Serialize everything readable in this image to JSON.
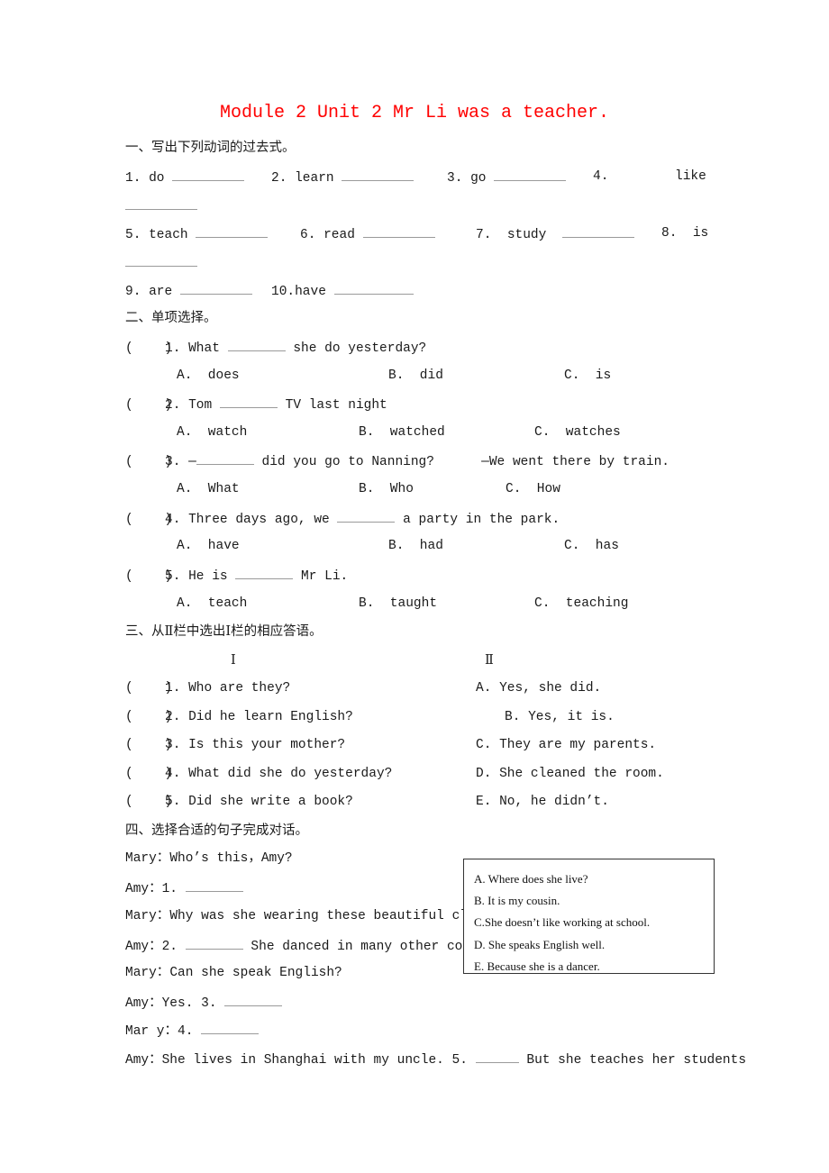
{
  "title": "Module 2 Unit 2 Mr Li was a teacher.",
  "section1": {
    "heading": "一、写出下列动词的过去式。",
    "items": [
      {
        "num": "1.",
        "word": "do"
      },
      {
        "num": "2.",
        "word": "learn"
      },
      {
        "num": "3.",
        "word": "go"
      },
      {
        "num": "4.",
        "word": "like"
      },
      {
        "num": "5.",
        "word": "teach"
      },
      {
        "num": "6.",
        "word": "read"
      },
      {
        "num": "7.",
        "word": "study"
      },
      {
        "num": "8.",
        "word": "is"
      },
      {
        "num": "9.",
        "word": "are"
      },
      {
        "num": "10.",
        "word": "have"
      }
    ]
  },
  "section2": {
    "heading": "二、单项选择。",
    "questions": [
      {
        "paren": "(    )",
        "num": "1.",
        "before": "What",
        "after": "she do yesterday?",
        "options": [
          "A.  does",
          "B.  did",
          "C.  is"
        ]
      },
      {
        "paren": "(    )",
        "num": "2.",
        "before": "Tom",
        "after": "TV last night",
        "options": [
          "A.  watch",
          "B.  watched",
          "C.  watches"
        ]
      },
      {
        "paren": "(    )",
        "num": "3.",
        "before": "—",
        "after": "did you go to Nanning?      —We went there by train.",
        "options": [
          "A.  What",
          "B.  Who",
          "C.  How"
        ]
      },
      {
        "paren": "(    )",
        "num": "4.",
        "before": "Three days ago, we",
        "after": "a party in the park.",
        "options": [
          "A.  have",
          "B.  had",
          "C.  has"
        ]
      },
      {
        "paren": "(    )",
        "num": "5.",
        "before": "He is",
        "after": "Mr Li.",
        "options": [
          "A.  teach",
          "B.  taught",
          "C.  teaching"
        ]
      }
    ]
  },
  "section3": {
    "heading": "三、从Ⅱ栏中选出Ⅰ栏的相应答语。",
    "col1_label": "Ⅰ",
    "col2_label": "Ⅱ",
    "questions": [
      {
        "paren": "(    )",
        "text": "1. Who are they?"
      },
      {
        "paren": "(    )",
        "text": "2. Did he learn English?"
      },
      {
        "paren": "(    )",
        "text": "3. Is this your mother?"
      },
      {
        "paren": "(    )",
        "text": "4. What did she do yesterday?"
      },
      {
        "paren": "(    )",
        "text": "5. Did she write a book?"
      }
    ],
    "answers": [
      "A. Yes, she did.",
      "B. Yes, it is.",
      "C. They are my parents.",
      "D. She cleaned the room.",
      "E. No, he didn’t."
    ]
  },
  "section4": {
    "heading": "四、选择合适的句子完成对话。",
    "dialogue": [
      {
        "speaker": "Mary：",
        "text": "Who’s this，Amy?"
      },
      {
        "speaker": "Amy：",
        "text": "1.",
        "blank": true,
        "after": ""
      },
      {
        "speaker": "Mary：",
        "text": "Why was she wearing these beautiful clot"
      },
      {
        "speaker": "Amy：",
        "text": "2.",
        "blank": true,
        "after": "She danced in many other coun"
      },
      {
        "speaker": "Mary：",
        "text": "Can she speak English?"
      },
      {
        "speaker": "Amy：",
        "text": "Yes. 3.",
        "blank": true,
        "after": ""
      },
      {
        "speaker": "Mar y：",
        "text": "4.",
        "blank": true,
        "after": ""
      },
      {
        "speaker": "Amy：",
        "text": "She lives in Shanghai with my uncle. 5.",
        "blank": true,
        "short": true,
        "after": "But she teaches her students"
      }
    ],
    "options": [
      "A. Where does she live?",
      "B. It is my cousin.",
      "C.She doesn’t like working at school.",
      "D. She speaks English well.",
      "E. Because she is a dancer."
    ]
  }
}
